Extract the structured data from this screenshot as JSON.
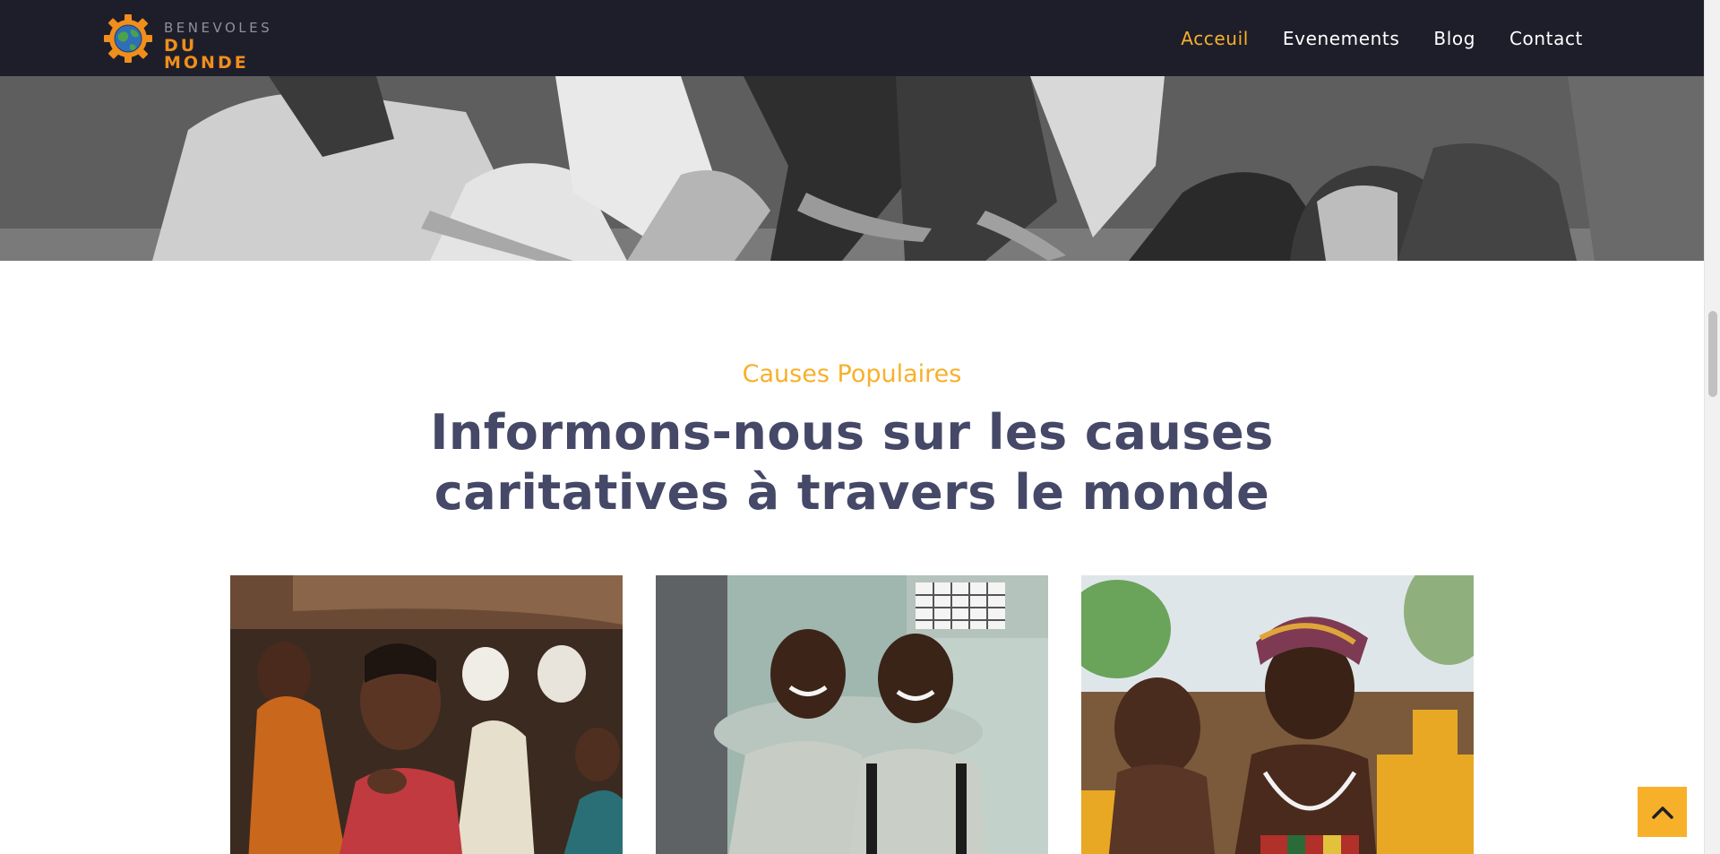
{
  "nav": {
    "logo": {
      "line1": "BENEVOLES",
      "line2": "DU MONDE"
    },
    "links": [
      {
        "label": "Acceuil",
        "active": true
      },
      {
        "label": "Evenements",
        "active": false
      },
      {
        "label": "Blog",
        "active": false
      },
      {
        "label": "Contact",
        "active": false
      }
    ]
  },
  "causes": {
    "eyebrow": "Causes Populaires",
    "headline_line1": "Informons-nous sur les causes",
    "headline_line2": "caritatives à travers le monde"
  },
  "colors": {
    "nav_bg": "#1e1e2b",
    "accent": "#f7b02a",
    "headline": "#454867",
    "logo_orange": "#f08e1c"
  },
  "icons": {
    "to_top": "chevron-up-icon",
    "logo_mark": "gear-globe-icon"
  }
}
